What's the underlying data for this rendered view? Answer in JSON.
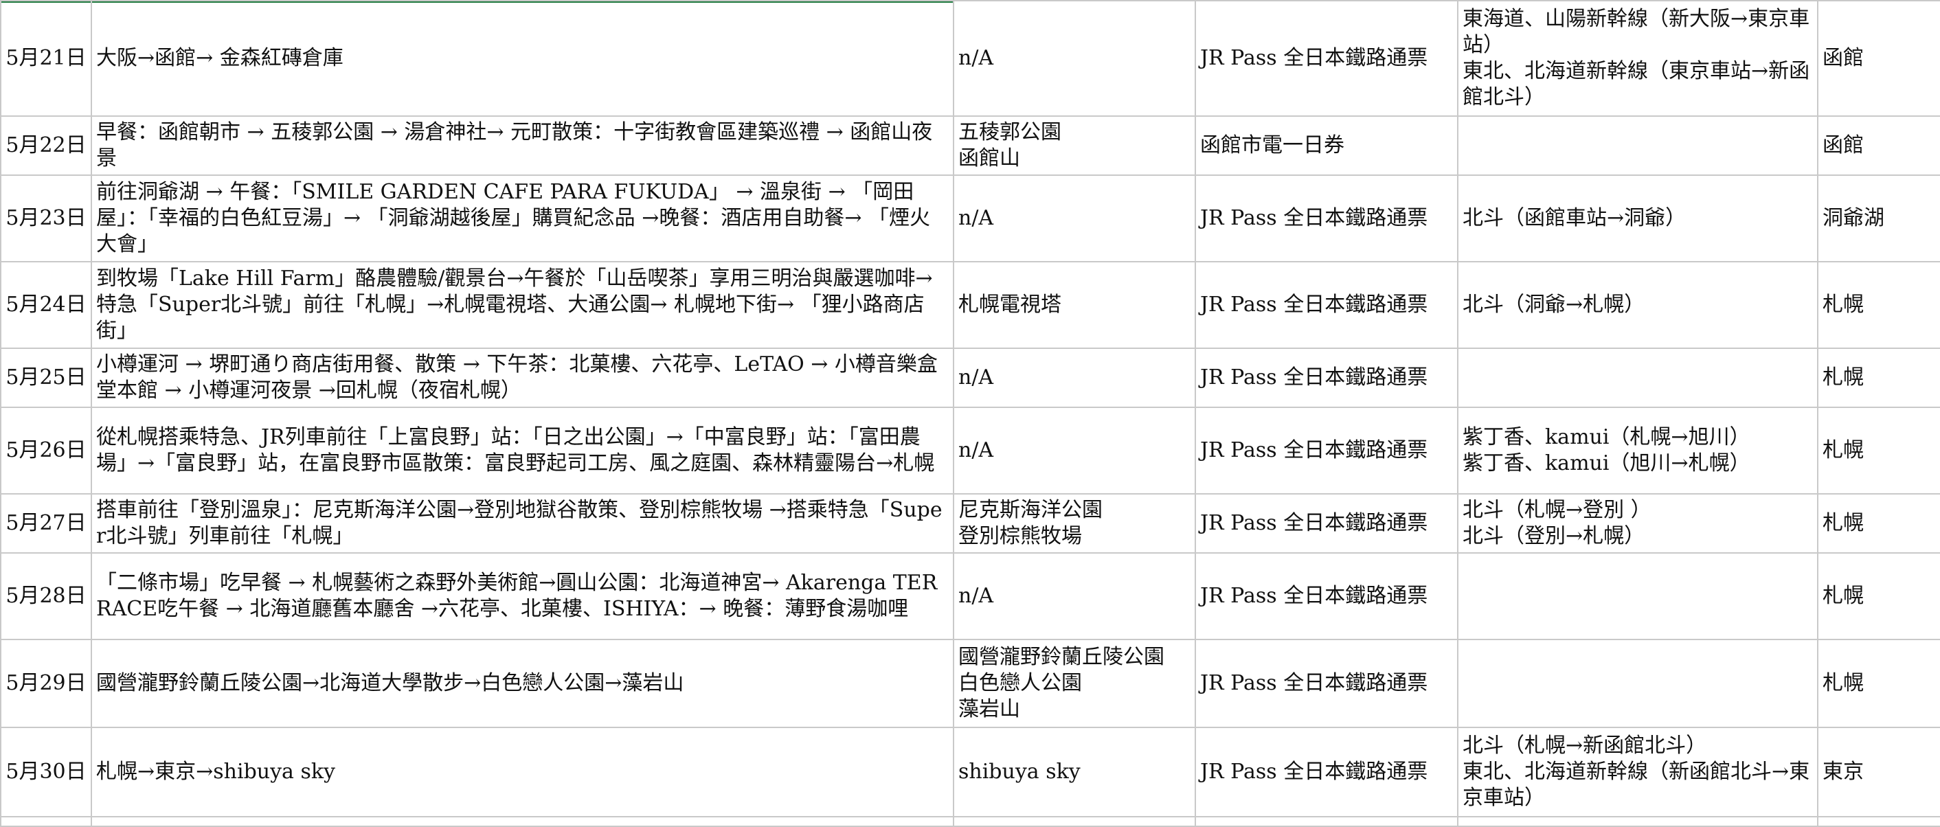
{
  "rows": [
    {
      "date": "5月21日",
      "itinerary": "大阪→函館→ 金森紅磚倉庫",
      "attractions": "n/A",
      "pass": "JR Pass 全日本鐵路通票",
      "trains": "東海道、山陽新幹線（新大阪→東京車站）\n東北、北海道新幹線（東京車站→新函館北斗）",
      "stay": "函館"
    },
    {
      "date": "5月22日",
      "itinerary": "早餐：函館朝市 → 五稜郭公園 → 湯倉神社→ 元町散策：十字街教會區建築巡禮 → 函館山夜景",
      "attractions": "五稜郭公園\n函館山",
      "pass": "函館市電一日券",
      "trains": "",
      "stay": "函館"
    },
    {
      "date": "5月23日",
      "itinerary": "前往洞爺湖 → 午餐：「SMILE GARDEN CAFE PARA FUKUDA」 → 溫泉街 → 「岡田屋」：「幸福的白色紅豆湯」→ 「洞爺湖越後屋」購買紀念品 →晚餐：酒店用自助餐→ 「煙火大會」",
      "attractions": "n/A",
      "pass": "JR Pass 全日本鐵路通票",
      "trains": "北斗（函館車站→洞爺）",
      "stay": "洞爺湖"
    },
    {
      "date": "5月24日",
      "itinerary": "到牧場「Lake Hill Farm」酪農體驗/觀景台→午餐於「山岳喫茶」享用三明治與嚴選咖啡→特急「Super北斗號」前往「札幌」→札幌電視塔、大通公園→ 札幌地下街→ 「狸小路商店街」",
      "attractions": "札幌電視塔",
      "pass": "JR Pass 全日本鐵路通票",
      "trains": "北斗（洞爺→札幌）",
      "stay": "札幌"
    },
    {
      "date": "5月25日",
      "itinerary": "小樽運河 → 堺町通り商店街用餐、散策 → 下午茶：北菓樓、六花亭、LeTAO → 小樽音樂盒堂本館 → 小樽運河夜景 →回札幌（夜宿札幌）",
      "attractions": "n/A",
      "pass": "JR Pass 全日本鐵路通票",
      "trains": "",
      "stay": "札幌"
    },
    {
      "date": "5月26日",
      "itinerary": "從札幌搭乘特急、JR列車前往「上富良野」站：「日之出公園」→「中富良野」站：「富田農場」→「富良野」站，在富良野市區散策：富良野起司工房、風之庭園、森林精靈陽台→札幌",
      "attractions": "n/A",
      "pass": "JR Pass 全日本鐵路通票",
      "trains": "紫丁香、kamui（札幌→旭川）\n紫丁香、kamui（旭川→札幌）",
      "stay": "札幌"
    },
    {
      "date": "5月27日",
      "itinerary": "搭車前往「登別溫泉」：尼克斯海洋公園→登別地獄谷散策、登別棕熊牧場 →搭乘特急「Super北斗號」列車前往「札幌」",
      "attractions": "尼克斯海洋公園\n登別棕熊牧場",
      "pass": "JR Pass 全日本鐵路通票",
      "trains": "北斗（札幌→登別 ）\n北斗（登別→札幌）",
      "stay": "札幌"
    },
    {
      "date": "5月28日",
      "itinerary": "「二條市場」吃早餐 → 札幌藝術之森野外美術館→圓山公園：北海道神宮→ Akarenga TERRACE吃午餐 → 北海道廳舊本廳舍 →六花亭、北菓樓、ISHIYA：→ 晚餐：薄野食湯咖哩",
      "attractions": "n/A",
      "pass": "JR Pass 全日本鐵路通票",
      "trains": "",
      "stay": "札幌"
    },
    {
      "date": "5月29日",
      "itinerary": "國營瀧野鈴蘭丘陵公園→北海道大學散步→白色戀人公園→藻岩山",
      "attractions": "國營瀧野鈴蘭丘陵公園\n白色戀人公園\n藻岩山",
      "pass": "JR Pass 全日本鐵路通票",
      "trains": "",
      "stay": "札幌"
    },
    {
      "date": "5月30日",
      "itinerary": "札幌→東京→shibuya sky",
      "attractions": "shibuya sky",
      "pass": "JR Pass 全日本鐵路通票",
      "trains": "北斗（札幌→新函館北斗）\n東北、北海道新幹線（新函館北斗→東京車站）",
      "stay": "東京"
    }
  ]
}
